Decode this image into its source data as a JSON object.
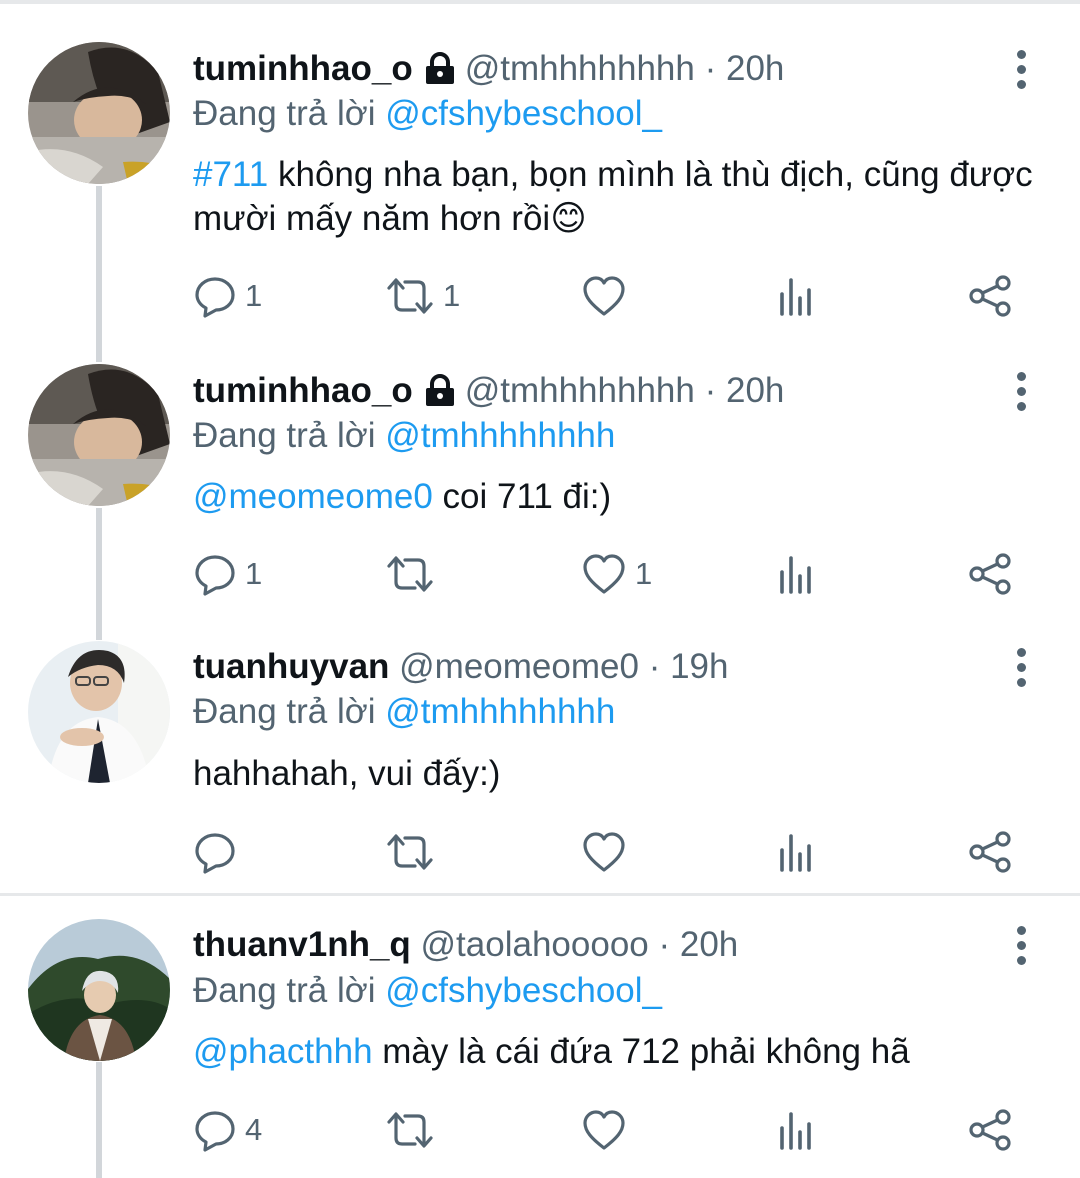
{
  "tweets": [
    {
      "name": "tuminhhao_o",
      "locked": true,
      "handle": "@tmhhhhhhhh",
      "separator": "·",
      "time": "20h",
      "replying_prefix": "Đang trả lời",
      "replying_to": "@cfshybeschool_",
      "body_link": "#711",
      "body_text": " không nha bạn, bọn mình là thù địch, cũng được mười mấy năm hơn rồi😊",
      "reply_count": "1",
      "retweet_count": "1",
      "like_count": ""
    },
    {
      "name": "tuminhhao_o",
      "locked": true,
      "handle": "@tmhhhhhhhh",
      "separator": "·",
      "time": "20h",
      "replying_prefix": "Đang trả lời",
      "replying_to": "@tmhhhhhhhh",
      "body_link": "@meomeome0",
      "body_text": " coi 711 đi:)",
      "reply_count": "1",
      "retweet_count": "",
      "like_count": "1"
    },
    {
      "name": "tuanhuyvan",
      "locked": false,
      "handle": "@meomeome0",
      "separator": "·",
      "time": "19h",
      "replying_prefix": "Đang trả lời",
      "replying_to": "@tmhhhhhhhh",
      "body_link": "",
      "body_text": "hahhahah, vui đấy:)",
      "reply_count": "",
      "retweet_count": "",
      "like_count": ""
    },
    {
      "name": "thuanv1nh_q",
      "locked": false,
      "handle": "@taolahooooo",
      "separator": "·",
      "time": "20h",
      "replying_prefix": "Đang trả lời",
      "replying_to": "@cfshybeschool_",
      "body_link": "@phacthhh",
      "body_text": " mày là cái đứa 712 phải không hã",
      "reply_count": "4",
      "retweet_count": "",
      "like_count": ""
    }
  ],
  "icons": {
    "reply": "reply-icon",
    "retweet": "retweet-icon",
    "like": "heart-icon",
    "analytics": "analytics-icon",
    "share": "share-icon",
    "more": "more-vertical-icon",
    "lock": "lock-icon"
  },
  "colors": {
    "link": "#1d9bf0",
    "muted": "#536471",
    "text": "#0f1419",
    "thread_line": "#d2d6da"
  }
}
